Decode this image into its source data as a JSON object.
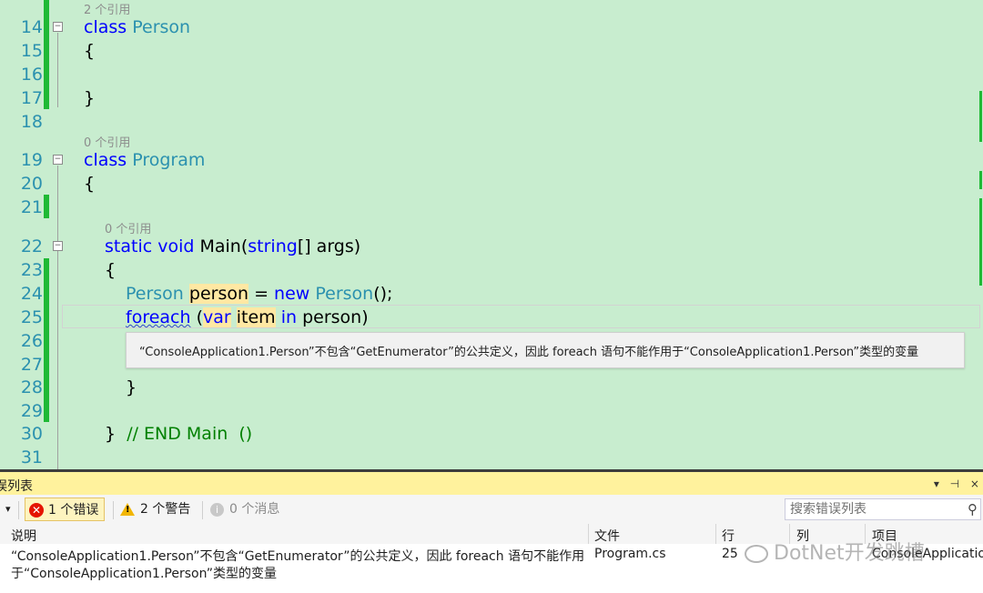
{
  "editor": {
    "line_numbers": [
      "14",
      "15",
      "16",
      "17",
      "18",
      "19",
      "20",
      "21",
      "22",
      "23",
      "24",
      "25",
      "26",
      "27",
      "28",
      "29",
      "30",
      "31"
    ],
    "codelens": {
      "person_refs": "2 个引用",
      "program_refs": "0 个引用",
      "main_refs": "0 个引用"
    },
    "code": {
      "l14_kw": "class",
      "l14_name": "Person",
      "brace_open": "{",
      "brace_close": "}",
      "l19_kw": "class",
      "l19_name": "Program",
      "l22_static": "static",
      "l22_void": "void",
      "l22_main": "Main(",
      "l22_string": "string",
      "l22_rest": "[] args)",
      "l24_type": "Person",
      "l24_var": "person",
      "l24_eq": " = ",
      "l24_new": "new",
      "l24_type2": "Person",
      "l24_end": "();",
      "l25_foreach": "foreach",
      "l25_paren": " (",
      "l25_var": "var",
      "l25_item": "item",
      "l25_in": "in",
      "l25_rest": " person)",
      "l30_brace": "}",
      "l30_comment": "// END Main  ()"
    },
    "error_tooltip": "“ConsoleApplication1.Person”不包含“GetEnumerator”的公共定义，因此 foreach 语句不能作用于“ConsoleApplication1.Person”类型的变量"
  },
  "error_list": {
    "title": "误列表",
    "window_controls": "▾ ⊣ ×",
    "dropdown_arrow": "▾",
    "errors_label": "1 个错误",
    "warnings_label": "2 个警告",
    "messages_label": "0 个消息",
    "search_placeholder": "搜索错误列表",
    "columns": {
      "description": "说明",
      "file": "文件",
      "line": "行",
      "column": "列",
      "project": "项目"
    },
    "row": {
      "description_line1": "“ConsoleApplication1.Person”不包含“GetEnumerator”的公共定义，因此 foreach 语句不能作用",
      "description_line2": "于“ConsoleApplication1.Person”类型的变量",
      "file": "Program.cs",
      "line": "25",
      "project": "ConsoleApplicatio"
    }
  },
  "watermark": "DotNet开发跳槽",
  "colors": {
    "editor_bg": "#c8edcf",
    "keyword": "#0000ff",
    "type": "#2b91af",
    "comment": "#008000",
    "change_bar": "#1fb935",
    "error_list_title_bg": "#fff29d",
    "error_icon": "#e51400",
    "warning_icon": "#f2b602"
  },
  "icons": {
    "errors": "error-circle-icon",
    "warnings": "warning-triangle-icon",
    "messages": "info-circle-icon",
    "search": "search-icon",
    "fold": "collapse-minus-icon"
  }
}
